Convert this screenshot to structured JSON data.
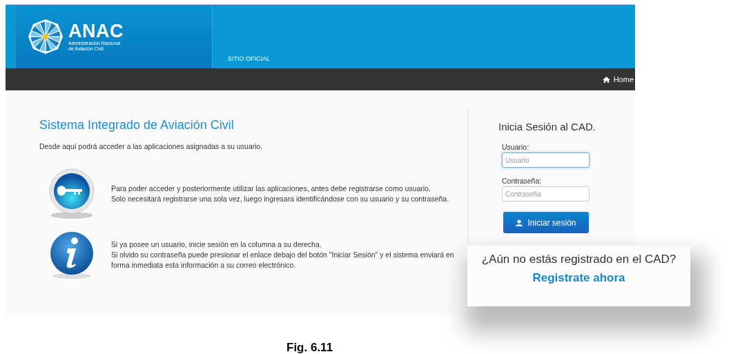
{
  "header": {
    "logo": {
      "title": "ANAC",
      "subtitle_lines": [
        "Administración Nacional",
        "de Aviación Civil"
      ]
    },
    "tagline": "SITIO OFICIAL"
  },
  "nav": {
    "items": [
      {
        "label": "Home"
      }
    ]
  },
  "intro": {
    "title": "Sistema Integrado de Aviación Civil",
    "description": "Desde aquí podrá acceder a las aplicaciones asignadas a su usuario."
  },
  "info_items": [
    {
      "kind": "key",
      "sentences": [
        "Para poder acceder y posteriormente utilizar las aplicaciones, antes debe registrarse como usuario.",
        "Solo necesitará registrarse una sola vez, luego ingresara identificándose con su usuario y su contraseña."
      ]
    },
    {
      "kind": "info",
      "sentences": [
        "Si ya posee un usuario, inicie sesión en la columna a su derecha.",
        "Si olvido su contraseña puede presionar el enlace debajo del botón \"Iniciar Sesión\" y el sistema enviará en forma inmediata esta información a su correo electrónico."
      ]
    }
  ],
  "login": {
    "title": "Inicia Sesión al CAD.",
    "fields": [
      {
        "label": "Usuario:",
        "placeholder": "Usuario",
        "focused": true
      },
      {
        "label": "Contraseña:",
        "placeholder": "Contraseña",
        "focused": false
      }
    ],
    "button": "Iniciar sesión"
  },
  "callout": {
    "question": "¿Aún no estás registrado en el CAD?",
    "link": "Registrate ahora"
  },
  "caption": "Fig. 6.11"
}
